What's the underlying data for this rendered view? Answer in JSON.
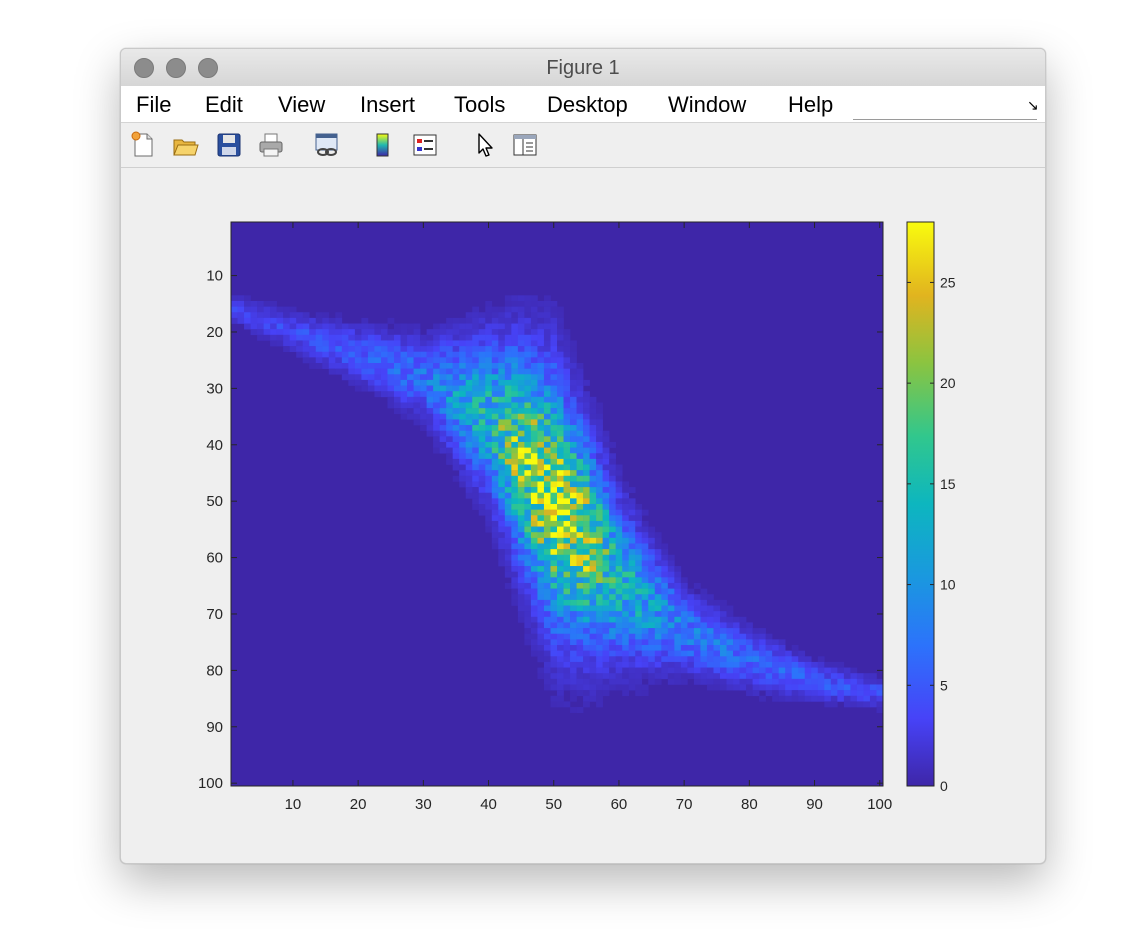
{
  "window": {
    "title": "Figure 1"
  },
  "menu": {
    "items": [
      {
        "label": "File"
      },
      {
        "label": "Edit"
      },
      {
        "label": "View"
      },
      {
        "label": "Insert"
      },
      {
        "label": "Tools"
      },
      {
        "label": "Desktop"
      },
      {
        "label": "Window"
      },
      {
        "label": "Help"
      }
    ]
  },
  "toolbar": {
    "icons": [
      "new-figure-icon",
      "open-file-icon",
      "save-icon",
      "print-icon",
      "link-plot-icon",
      "insert-colorbar-icon",
      "insert-legend-icon",
      "edit-plot-pointer-icon",
      "property-inspector-icon"
    ]
  },
  "colors": {
    "background_cell": "#3E26A8",
    "colormap": "parula"
  },
  "chart_data": {
    "type": "heatmap",
    "description_of_data": "2-D histogram counts on a 100 x 100 grid",
    "x_range": [
      1,
      100
    ],
    "y_range": [
      1,
      100
    ],
    "y_direction": "reverse",
    "xticks": [
      10,
      20,
      30,
      40,
      50,
      60,
      70,
      80,
      90,
      100
    ],
    "yticks": [
      10,
      20,
      30,
      40,
      50,
      60,
      70,
      80,
      90,
      100
    ],
    "density_ridge": {
      "x": [
        1,
        10,
        20,
        30,
        40,
        45,
        50,
        55,
        60,
        70,
        80,
        90,
        100
      ],
      "y_center": [
        16,
        20,
        24,
        28,
        35,
        42,
        50,
        57,
        64,
        73,
        78,
        82,
        84
      ],
      "half_width": [
        1.5,
        2,
        3,
        4,
        8,
        11,
        13,
        11,
        8,
        4,
        3,
        2,
        1.5
      ],
      "peak_count": [
        3,
        4,
        5,
        7,
        14,
        21,
        25,
        21,
        14,
        8,
        6,
        5,
        4
      ]
    },
    "colorbar": {
      "clim": [
        0,
        28
      ],
      "ticks": [
        0,
        5,
        10,
        15,
        20,
        25
      ],
      "location": "right"
    }
  }
}
